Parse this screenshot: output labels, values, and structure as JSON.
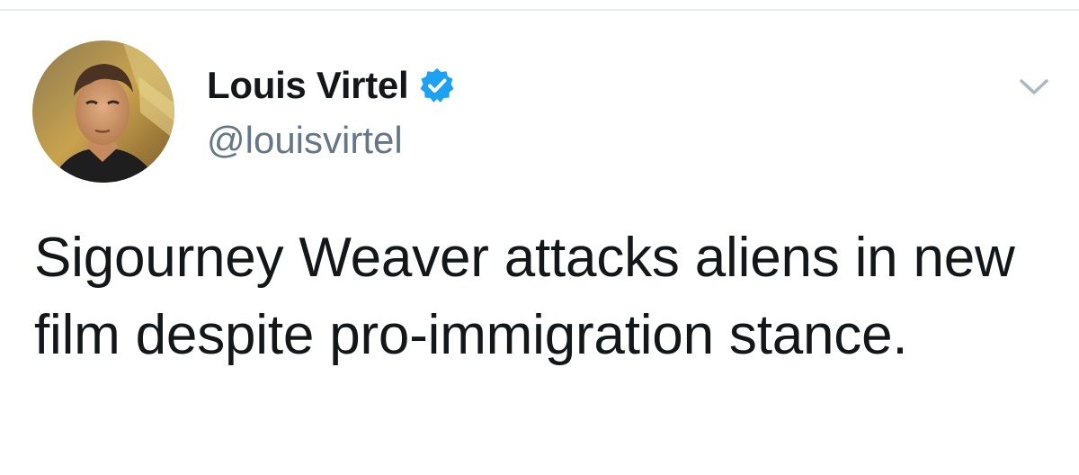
{
  "tweet": {
    "author": {
      "name": "Louis Virtel",
      "handle": "@louisvirtel",
      "verified": true
    },
    "text": "Sigourney Weaver attacks aliens in new film despite pro-immigration stance."
  },
  "icons": {
    "verified": "verified-check-icon",
    "menu": "chevron-down-icon"
  },
  "colors": {
    "verified_blue": "#1da1f2",
    "text_primary": "#14171a",
    "text_secondary": "#657786",
    "chevron": "#aab8c2",
    "divider": "#e6ecf0"
  }
}
